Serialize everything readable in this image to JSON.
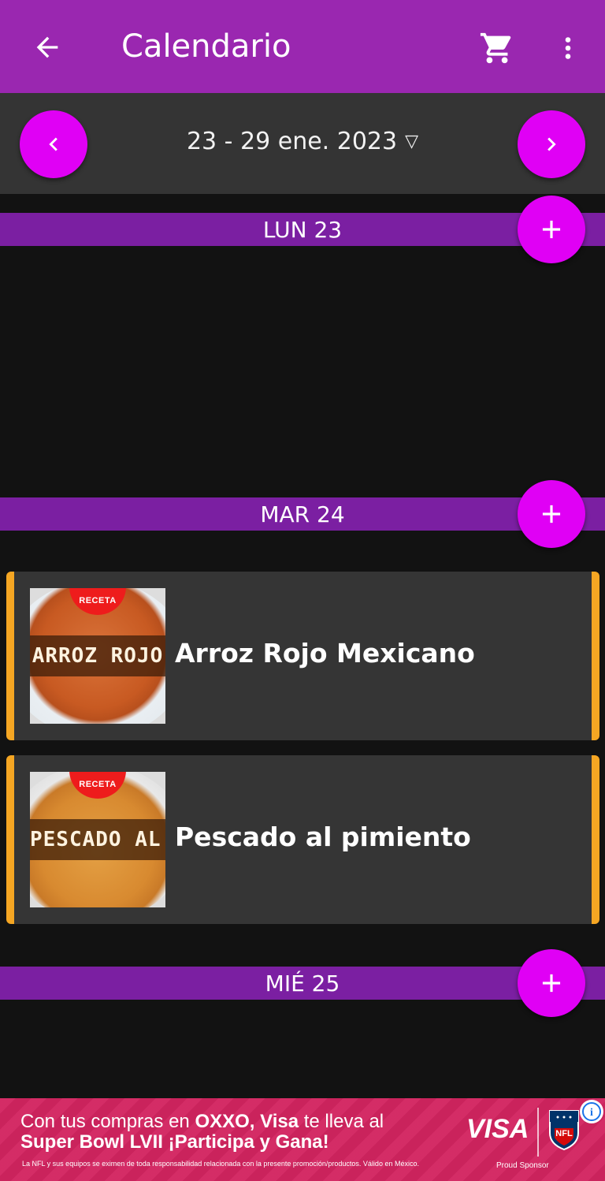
{
  "appbar": {
    "title": "Calendario",
    "back_icon": "arrow-left-icon",
    "cart_icon": "cart-icon",
    "more_icon": "more-vertical-icon",
    "color": "#9a27b0"
  },
  "week": {
    "label": "23 - 29 ene. 2023",
    "dropdown_glyph": "▽",
    "prev_icon": "chevron-left-icon",
    "next_icon": "chevron-right-icon"
  },
  "days": [
    {
      "label": "LUN 23",
      "recipes": []
    },
    {
      "label": "MAR 24",
      "recipes": [
        {
          "name": "Arroz Rojo Mexicano",
          "badge": "RECETA",
          "banner": "ARROZ ROJO"
        },
        {
          "name": "Pescado al pimiento",
          "badge": "RECETA",
          "banner": "PESCADO AL PIMIENTO"
        }
      ]
    },
    {
      "label": "MIÉ 25",
      "recipes": []
    }
  ],
  "ad": {
    "line1_prefix": "Con tus compras en ",
    "line1_brand1": "OXXO",
    "line1_mid": ", ",
    "line1_brand2": "Visa",
    "line1_suffix": " te lleva al",
    "line2": "Super Bowl LVII ¡Participa y Gana!",
    "legal": "La NFL y sus equipos se eximen de toda responsabilidad relacionada con la presente promoción/productos. Válido en México.",
    "brand": "VISA",
    "sponsor": "Proud Sponsor",
    "info": "i"
  },
  "colors": {
    "accent": "#e000f5",
    "day_header": "#7b1fa2",
    "card_border": "#f5a623"
  }
}
